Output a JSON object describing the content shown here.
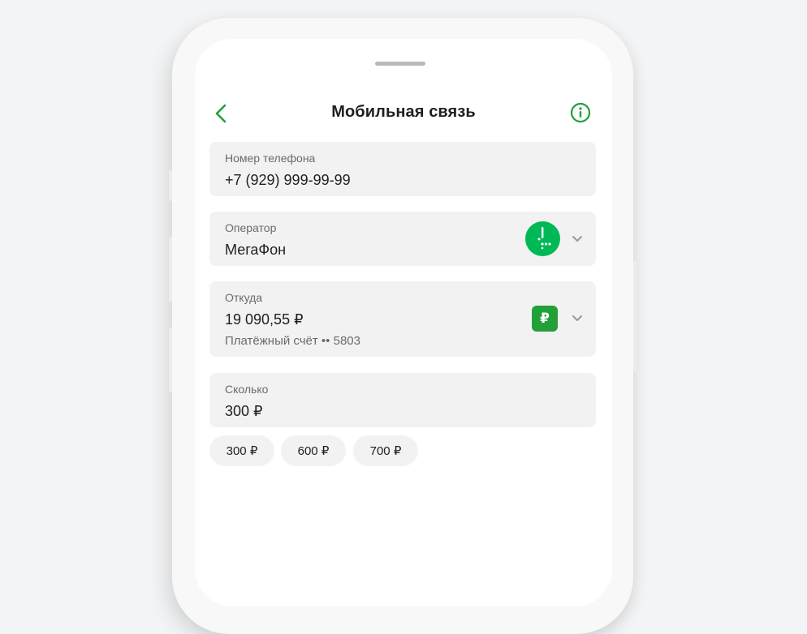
{
  "header": {
    "title": "Мобильная связь"
  },
  "phone": {
    "label": "Номер телефона",
    "value": "+7 (929) 999-99-99"
  },
  "operator": {
    "label": "Оператор",
    "value": "МегаФон",
    "logo_color": "#00b956"
  },
  "source": {
    "label": "Откуда",
    "balance": "19 090,55 ₽",
    "account": "Платёжный счёт •• 5803",
    "badge_symbol": "₽",
    "badge_color": "#21a038"
  },
  "amount": {
    "label": "Сколько",
    "value": "300 ₽"
  },
  "quick_amounts": [
    "300 ₽",
    "600 ₽",
    "700 ₽"
  ],
  "colors": {
    "accent": "#21a038",
    "field_bg": "#f2f2f2",
    "label": "#6b6b6b"
  }
}
